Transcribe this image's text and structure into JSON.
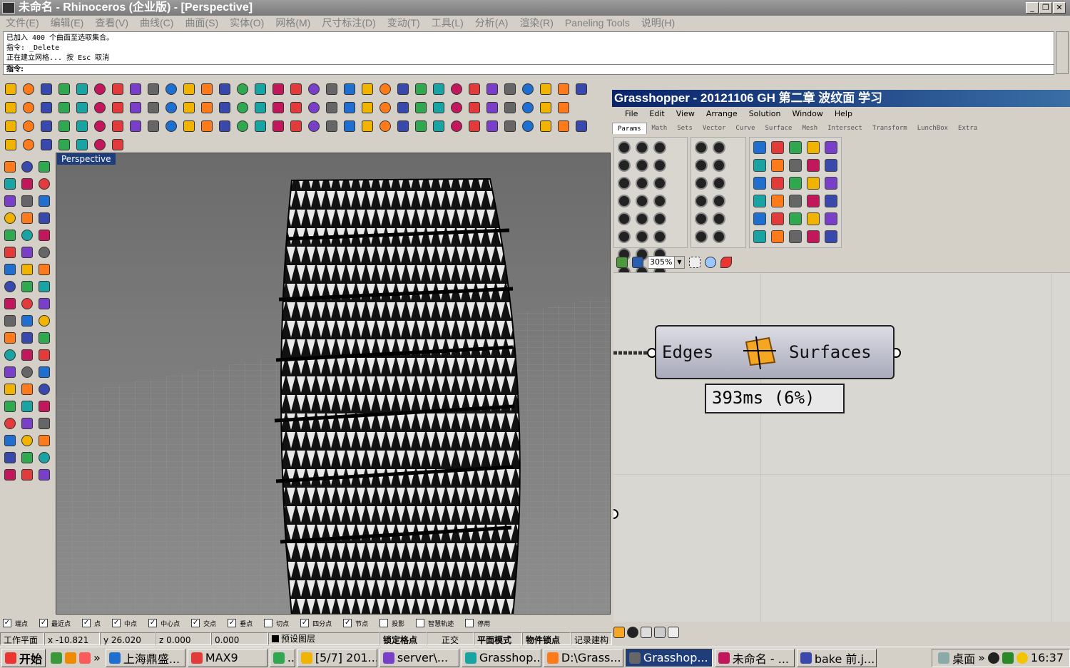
{
  "window": {
    "title": "未命名 - Rhinoceros (企业版) - [Perspective]",
    "min_icon": "minimize-icon",
    "max_icon": "restore-icon",
    "close_icon": "close-icon"
  },
  "menubar": [
    "文件(E)",
    "编辑(E)",
    "查看(V)",
    "曲线(C)",
    "曲面(S)",
    "实体(O)",
    "网格(M)",
    "尺寸标注(D)",
    "变动(T)",
    "工具(L)",
    "分析(A)",
    "渲染(R)",
    "Paneling Tools",
    "说明(H)"
  ],
  "command": {
    "history": [
      "已加入 400 个曲面至选取集合。",
      "指令: _Delete",
      "正在建立网格... 按 Esc 取消"
    ],
    "prompt": "指令:"
  },
  "viewport": {
    "label": "Perspective"
  },
  "grasshopper": {
    "title": "Grasshopper - 20121106 GH 第二章 波纹面 学习",
    "menu": [
      "File",
      "Edit",
      "View",
      "Arrange",
      "Solution",
      "Window",
      "Help"
    ],
    "tabs": [
      "Params",
      "Math",
      "Sets",
      "Vector",
      "Curve",
      "Surface",
      "Mesh",
      "Intersect",
      "Transform",
      "LunchBox",
      "Extra"
    ],
    "zoom": "305%",
    "component": {
      "input": "Edges",
      "output": "Surfaces",
      "icon": "edge-surface-icon"
    },
    "profiler": "393ms (6%)"
  },
  "snaps": [
    {
      "label": "端点",
      "checked": true
    },
    {
      "label": "最近点",
      "checked": true
    },
    {
      "label": "点",
      "checked": true
    },
    {
      "label": "中点",
      "checked": true
    },
    {
      "label": "中心点",
      "checked": true
    },
    {
      "label": "交点",
      "checked": true
    },
    {
      "label": "垂点",
      "checked": true
    },
    {
      "label": "切点",
      "checked": false
    },
    {
      "label": "四分点",
      "checked": true
    },
    {
      "label": "节点",
      "checked": true
    },
    {
      "label": "投影",
      "checked": false
    },
    {
      "label": "智慧轨迹",
      "checked": false
    },
    {
      "label": "停用",
      "checked": false
    }
  ],
  "status": {
    "cplane": "工作平面",
    "x": "x -10.821",
    "y": "y 26.020",
    "z": "z 0.000",
    "extra": "0.000",
    "layer": "预设图层",
    "lock": "锁定格点",
    "ortho": "正交",
    "planar": "平面模式",
    "osnap": "物件锁点",
    "history": "记录建构"
  },
  "taskbar": {
    "start": "开始",
    "items": [
      "上海鼎盛...",
      "MAX9",
      "...",
      "[5/7] 201...",
      "server\\...",
      "Grasshop...",
      "D:\\Grass...",
      "Grasshop...",
      "未命名 - ...",
      "bake 前.j..."
    ],
    "desktop": "桌面",
    "clock": "16:37"
  },
  "colors": {
    "accent": "#0a246a",
    "viewport": "#7a7a7a",
    "ghcanvas": "#d8d7d1"
  }
}
